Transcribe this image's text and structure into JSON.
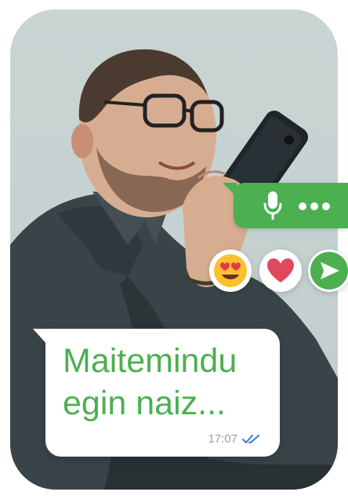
{
  "colors": {
    "accent_green": "#4caf50",
    "heart_red": "#e0485c",
    "tick_blue": "#3a7bd5",
    "background_grey": "#c6d2d1"
  },
  "photo": {
    "subject": "man with glasses and beard speaking into a smartphone",
    "icon": "person-photo"
  },
  "voice_message": {
    "icon": "microphone-icon",
    "status_icon": "ellipsis-icon"
  },
  "reactions": [
    {
      "icon": "heart-eyes-emoji-icon"
    },
    {
      "icon": "heart-icon"
    },
    {
      "icon": "send-arrow-icon"
    }
  ],
  "message": {
    "text": "Maitemindu\negin naiz...",
    "time": "17:07",
    "status_icon": "double-check-icon"
  }
}
